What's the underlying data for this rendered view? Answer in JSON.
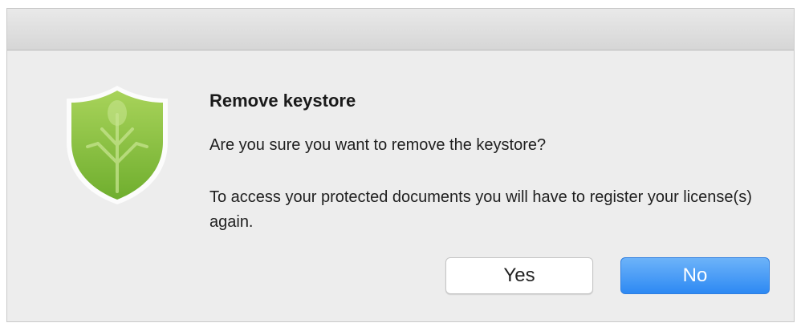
{
  "dialog": {
    "title": "Remove keystore",
    "question": "Are you sure you want to remove the keystore?",
    "info": "To access your protected documents you will have to register your license(s) again.",
    "icon": "green-shield-leaf-icon"
  },
  "buttons": {
    "yes_label": "Yes",
    "no_label": "No"
  },
  "colors": {
    "accent_blue": "#2d89f3",
    "shield_green": "#8cc63f"
  }
}
